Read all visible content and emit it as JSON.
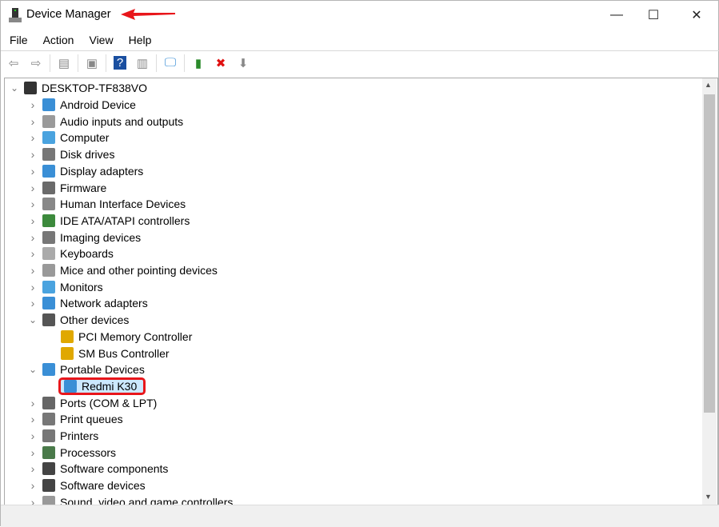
{
  "window": {
    "title": "Device Manager",
    "minimize": "—",
    "maximize": "☐",
    "close": "✕"
  },
  "menu": [
    "File",
    "Action",
    "View",
    "Help"
  ],
  "toolbar": [
    {
      "icon": "back-arrow-icon",
      "g": "⇦"
    },
    {
      "icon": "forward-arrow-icon",
      "g": "⇨"
    },
    {
      "icon": "show-hide-console-tree-icon",
      "g": "▤"
    },
    {
      "icon": "properties-icon",
      "g": "▣"
    },
    {
      "icon": "help-icon",
      "g": "?"
    },
    {
      "icon": "action-pane-icon",
      "g": "▥"
    },
    {
      "icon": "scan-hardware-icon",
      "g": "🖵"
    },
    {
      "icon": "update-driver-icon",
      "g": "▮"
    },
    {
      "icon": "uninstall-icon",
      "g": "✖"
    },
    {
      "icon": "disable-device-icon",
      "g": "⬇"
    }
  ],
  "tree": {
    "root": "DESKTOP-TF838VO",
    "items": [
      {
        "label": "Android Device",
        "color": "#3a8fd6"
      },
      {
        "label": "Audio inputs and outputs",
        "color": "#9a9a9a"
      },
      {
        "label": "Computer",
        "color": "#4aa3df"
      },
      {
        "label": "Disk drives",
        "color": "#777777"
      },
      {
        "label": "Display adapters",
        "color": "#3a8fd6"
      },
      {
        "label": "Firmware",
        "color": "#6a6a6a"
      },
      {
        "label": "Human Interface Devices",
        "color": "#888888"
      },
      {
        "label": "IDE ATA/ATAPI controllers",
        "color": "#3c8a3c"
      },
      {
        "label": "Imaging devices",
        "color": "#777777"
      },
      {
        "label": "Keyboards",
        "color": "#aaaaaa"
      },
      {
        "label": "Mice and other pointing devices",
        "color": "#999999"
      },
      {
        "label": "Monitors",
        "color": "#4aa3df"
      },
      {
        "label": "Network adapters",
        "color": "#3a8fd6"
      },
      {
        "label": "Other devices",
        "color": "#555555",
        "expanded": true,
        "children": [
          {
            "label": "PCI Memory Controller",
            "color": "#e0a800"
          },
          {
            "label": "SM Bus Controller",
            "color": "#e0a800"
          }
        ]
      },
      {
        "label": "Portable Devices",
        "color": "#3a8fd6",
        "expanded": true,
        "children": [
          {
            "label": "Redmi K30",
            "color": "#3a8fd6",
            "selected": true
          }
        ]
      },
      {
        "label": "Ports (COM & LPT)",
        "color": "#666666"
      },
      {
        "label": "Print queues",
        "color": "#777777"
      },
      {
        "label": "Printers",
        "color": "#777777"
      },
      {
        "label": "Processors",
        "color": "#4a7a4a"
      },
      {
        "label": "Software components",
        "color": "#444444"
      },
      {
        "label": "Software devices",
        "color": "#444444"
      },
      {
        "label": "Sound, video and game controllers",
        "color": "#999999"
      }
    ]
  },
  "annotation_color": "#e8161b"
}
